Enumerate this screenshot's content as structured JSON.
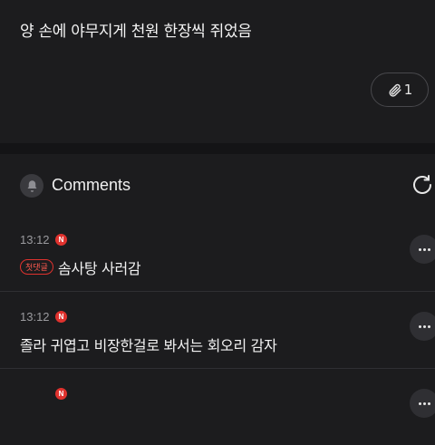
{
  "post": {
    "text": "양 손에 야무지게 천원 한장씩 쥐었음",
    "attachment_count": "1"
  },
  "comments_section": {
    "title": "Comments"
  },
  "comments": [
    {
      "time": "13:12",
      "new_badge": "N",
      "first_tag": "첫댓글",
      "text": "솜사탕 사러감"
    },
    {
      "time": "13:12",
      "new_badge": "N",
      "text": "졸라 귀엽고 비장한걸로 봐서는 회오리 감자"
    },
    {
      "time": "",
      "new_badge": "N",
      "text": ""
    }
  ],
  "colors": {
    "background": "#1c1c1e",
    "badge_red": "#e0322e"
  },
  "icons": [
    "paperclip-icon",
    "bell-icon",
    "refresh-icon",
    "more-icon"
  ]
}
